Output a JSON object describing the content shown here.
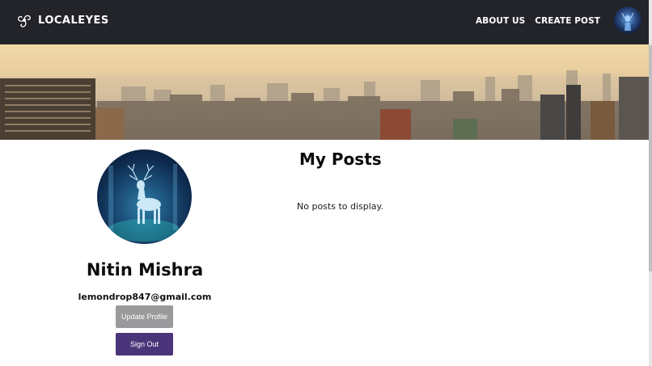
{
  "header": {
    "brand": "LOCALEYES",
    "nav": [
      "ABOUT US",
      "CREATE POST"
    ],
    "avatar_icon": "user-avatar-icon",
    "background_color": "#23242a"
  },
  "profile": {
    "name": "Nitin Mishra",
    "email": "lemondrop847@gmail.com",
    "update_button": "Update Profile",
    "signout_button": "Sign Out",
    "update_button_color": "#9a9a9d",
    "signout_button_color": "#4b357a"
  },
  "posts": {
    "title": "My Posts",
    "empty_message": "No posts to display."
  }
}
